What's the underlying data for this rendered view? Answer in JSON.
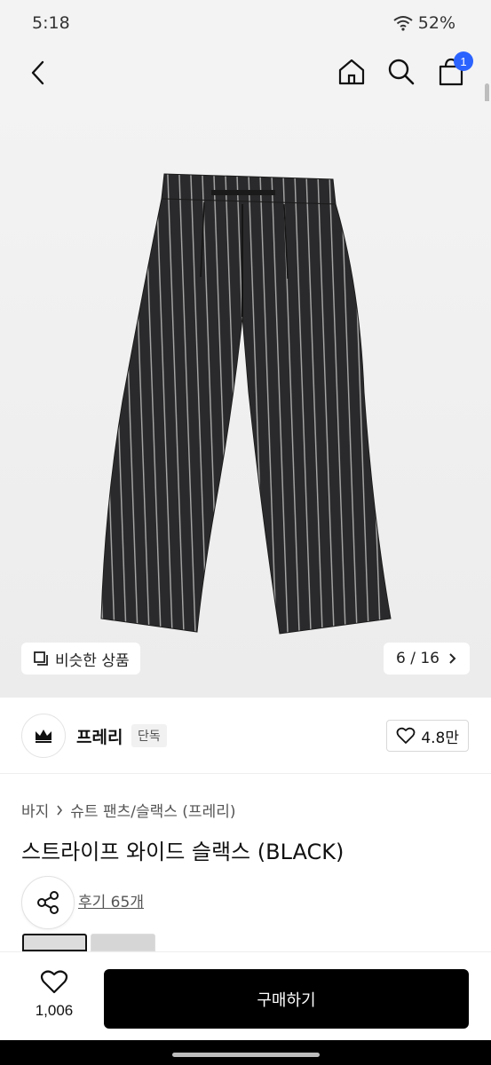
{
  "status": {
    "time": "5:18",
    "battery": "52%"
  },
  "header": {
    "cart_count": "1"
  },
  "gallery": {
    "similar_label": "비슷한 상품",
    "page_indicator": "6 / 16"
  },
  "brand": {
    "name": "프레리",
    "tag": "단독",
    "likes": "4.8만"
  },
  "breadcrumb": [
    "바지",
    "슈트 팬츠/슬랙스 (프레리)"
  ],
  "product": {
    "title": "스트라이프 와이드 슬랙스 (BLACK)",
    "reviews": "후기 65개"
  },
  "bottom": {
    "wish_count": "1,006",
    "buy_label": "구매하기"
  },
  "colors": {
    "accent": "#2b63ff",
    "buy_bg": "#000000"
  }
}
